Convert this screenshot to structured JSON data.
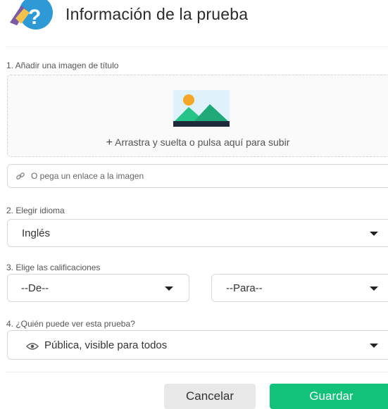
{
  "header": {
    "title": "Información de la prueba"
  },
  "sections": {
    "title_image": {
      "label": "1. Añadir una imagen de título",
      "drop_plus": "+",
      "drop_text": "Arrastra y suelta o pulsa aquí para subir",
      "link_placeholder": "O pega un enlace a la imagen"
    },
    "language": {
      "label": "2. Elegir idioma",
      "selected": "Inglés"
    },
    "grades": {
      "label": "3. Elige las calificaciones",
      "from_selected": "--De--",
      "to_selected": "--Para--"
    },
    "visibility": {
      "label": "4. ¿Quién puede ver esta prueba?",
      "selected": "Pública, visible para todos"
    }
  },
  "buttons": {
    "cancel": "Cancelar",
    "save": "Guardar"
  },
  "colors": {
    "save_button": "#12c17a",
    "cancel_button": "#e8e8e8"
  }
}
